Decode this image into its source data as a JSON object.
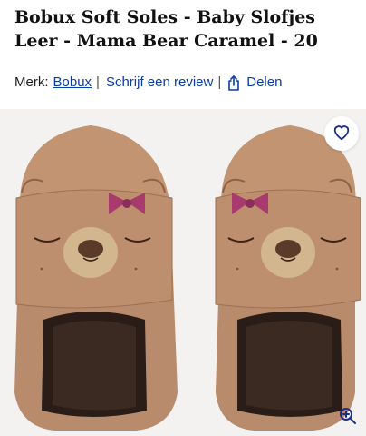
{
  "product": {
    "title": "Bobux Soft Soles - Baby Slofjes Leer - Mama Bear Caramel - 20"
  },
  "meta": {
    "brand_label": "Merk:",
    "brand_name": "Bobux",
    "separator": "|",
    "review_label": "Schrijf een review",
    "share_label": "Delen"
  },
  "image": {
    "shoe_color": "#b98b6d",
    "bow_color": "#a83a6e"
  },
  "icons": {
    "favorite": "heart-icon",
    "share": "share-icon",
    "zoom": "zoom-in-icon"
  },
  "colors": {
    "link": "#0a3ea8",
    "icon": "#1a2f8a"
  }
}
